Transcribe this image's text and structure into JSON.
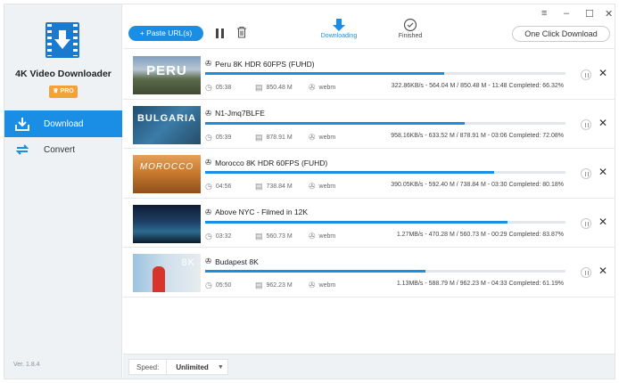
{
  "app": {
    "name": "4K Video Downloader",
    "pro_label": "PRO",
    "version": "Ver. 1.8.4"
  },
  "sidebar": {
    "items": [
      {
        "label": "Download"
      },
      {
        "label": "Convert"
      }
    ]
  },
  "toolbar": {
    "paste_label": "+ Paste URL(s)",
    "tabs": [
      {
        "label": "Downloading"
      },
      {
        "label": "Finished"
      }
    ],
    "one_click_label": "One Click Download",
    "window_controls": [
      "≡",
      "–",
      "☐",
      "✕"
    ]
  },
  "downloads": [
    {
      "title": "Peru 8K HDR 60FPS (FUHD)",
      "duration": "05:38",
      "size": "850.48 M",
      "format": "webm",
      "stats": "322.86KB/s - 564.04 M / 850.48 M - 11:48  Completed: 66.32%",
      "progress": 0.6632,
      "thumb_text": "PERU"
    },
    {
      "title": "N1-Jmq7BLFE",
      "duration": "05:39",
      "size": "878.91 M",
      "format": "webm",
      "stats": "958.16KB/s - 633.52 M / 878.91 M - 03:06  Completed: 72.08%",
      "progress": 0.7208,
      "thumb_text": "BULGARIA"
    },
    {
      "title": "Morocco 8K HDR 60FPS (FUHD)",
      "duration": "04:56",
      "size": "738.84 M",
      "format": "webm",
      "stats": "390.05KB/s - 592.40 M / 738.84 M - 03:30  Completed: 80.18%",
      "progress": 0.8018,
      "thumb_text": "MOROCCO"
    },
    {
      "title": "Above NYC - Filmed in 12K",
      "duration": "03:32",
      "size": "560.73 M",
      "format": "webm",
      "stats": "1.27MB/s - 470.28 M / 560.73 M - 00:29  Completed: 83.87%",
      "progress": 0.8387,
      "thumb_text": ""
    },
    {
      "title": "Budapest 8K",
      "duration": "05:50",
      "size": "962.23 M",
      "format": "webm",
      "stats": "1.13MB/s - 588.79 M / 962.23 M - 04:33  Completed: 61.19%",
      "progress": 0.6119,
      "thumb_text": "8K"
    }
  ],
  "bottom": {
    "speed_label": "Speed:",
    "speed_value": "Unlimited"
  },
  "colors": {
    "accent": "#1a8ee4",
    "pro": "#f2a23a",
    "sidebar_bg": "#eef2f5"
  }
}
